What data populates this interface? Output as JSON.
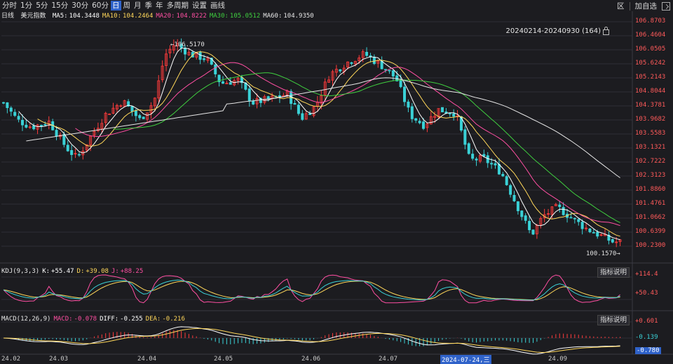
{
  "toolbar": {
    "periods": [
      "分时",
      "1分",
      "5分",
      "15分",
      "30分",
      "60分",
      "日",
      "周",
      "月",
      "季",
      "年",
      "多周期",
      "设置",
      "画线"
    ],
    "active_period": "日",
    "right": {
      "region": "区",
      "add_watch": "加自选"
    }
  },
  "ma_bar": {
    "period": "日线",
    "name": "美元指数",
    "items": [
      {
        "label": "MA5:",
        "value": "104.3448",
        "color": "#ffffff"
      },
      {
        "label": "MA10:",
        "value": "104.2464",
        "color": "#ffd75a"
      },
      {
        "label": "MA20:",
        "value": "104.8222",
        "color": "#ff4fa2"
      },
      {
        "label": "MA30:",
        "value": "105.0512",
        "color": "#3fcf3f"
      },
      {
        "label": "MA60:",
        "value": "104.9350",
        "color": "#e6e6e6"
      }
    ]
  },
  "range_label": "20240214-20240930 (164)",
  "price_axis": [
    "106.8703",
    "106.4604",
    "106.0505",
    "105.6242",
    "105.2143",
    "104.8044",
    "104.3781",
    "103.9682",
    "103.5583",
    "103.1321",
    "102.7222",
    "102.3123",
    "101.8860",
    "101.4761",
    "101.0662",
    "100.6399",
    "100.2300"
  ],
  "high_tag": "106.5170",
  "low_tag": "100.1570",
  "kdj": {
    "params": "KDJ(9,3,3)",
    "k": {
      "label": "K:",
      "value": "+55.47",
      "color": "#ffffff"
    },
    "d": {
      "label": "D:",
      "value": "+39.08",
      "color": "#ffd75a"
    },
    "j": {
      "label": "J:",
      "value": "+88.25",
      "color": "#ff4fa2"
    },
    "axis": [
      "+114.4",
      "+50.43"
    ],
    "explain": "指标说明"
  },
  "macd": {
    "params": "MACD(12,26,9)",
    "macd": {
      "label": "MACD:",
      "value": "-0.078",
      "color": "#ff4fa2"
    },
    "diff": {
      "label": "DIFF:",
      "value": "-0.255",
      "color": "#ffffff"
    },
    "dea": {
      "label": "DEA:",
      "value": "-0.216",
      "color": "#ffd75a"
    },
    "axis": [
      "+0.601",
      "-0.139",
      "-0.780"
    ],
    "explain": "指标说明"
  },
  "dates": [
    "24.02",
    "24.03",
    "24.04",
    "24.05",
    "24.06",
    "24.07",
    "24.09"
  ],
  "date_cursor": "2024-07-24,三",
  "colors": {
    "up": "#ff3b3b",
    "down": "#3ad1d6",
    "grid": "#2e2e36",
    "axis_text": "#ff5a5a"
  },
  "chart_data": {
    "type": "candlestick",
    "ylim": [
      100.0,
      107.0
    ],
    "series": [
      {
        "name": "MA5",
        "values": []
      },
      {
        "name": "MA10",
        "values": []
      }
    ]
  }
}
